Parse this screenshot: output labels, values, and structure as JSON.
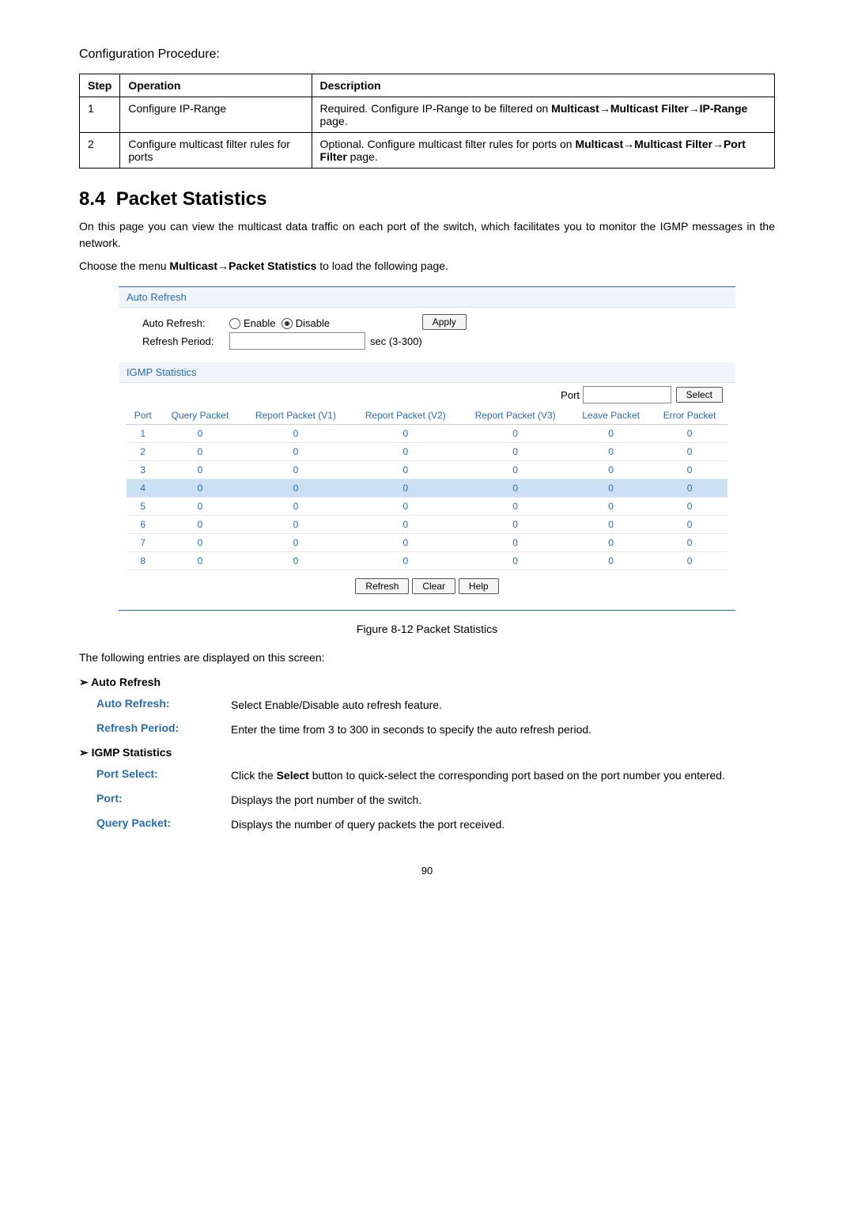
{
  "proc_title": "Configuration Procedure:",
  "table1": {
    "headers": [
      "Step",
      "Operation",
      "Description"
    ],
    "rows": [
      {
        "step": "1",
        "op": "Configure IP-Range",
        "desc_pre": "Required. Configure IP-Range to be filtered on ",
        "desc_bold": "Multicast→Multicast Filter→IP-Range",
        "desc_post": " page."
      },
      {
        "step": "2",
        "op": "Configure multicast filter rules for ports",
        "desc_pre": "Optional. Configure multicast filter rules for ports on ",
        "desc_bold": "Multicast→Multicast Filter→Port Filter",
        "desc_post": " page."
      }
    ]
  },
  "section_num": "8.4",
  "section_title": "Packet Statistics",
  "para1": "On this page you can view the multicast data traffic on each port of the switch, which facilitates you to monitor the IGMP messages in the network.",
  "para2_pre": "Choose the menu ",
  "para2_bold": "Multicast→Packet Statistics",
  "para2_post": " to load the following page.",
  "fig": {
    "auto_refresh_hdr": "Auto Refresh",
    "auto_refresh_label": "Auto Refresh:",
    "refresh_period_label": "Refresh Period:",
    "enable": "Enable",
    "disable": "Disable",
    "sec_hint": "sec (3-300)",
    "apply": "Apply",
    "igmp_hdr": "IGMP Statistics",
    "port_label": "Port",
    "select_btn": "Select",
    "cols": [
      "Port",
      "Query Packet",
      "Report Packet (V1)",
      "Report Packet (V2)",
      "Report Packet (V3)",
      "Leave Packet",
      "Error Packet"
    ],
    "rows": [
      {
        "port": "1",
        "q": "0",
        "r1": "0",
        "r2": "0",
        "r3": "0",
        "lv": "0",
        "er": "0"
      },
      {
        "port": "2",
        "q": "0",
        "r1": "0",
        "r2": "0",
        "r3": "0",
        "lv": "0",
        "er": "0"
      },
      {
        "port": "3",
        "q": "0",
        "r1": "0",
        "r2": "0",
        "r3": "0",
        "lv": "0",
        "er": "0"
      },
      {
        "port": "4",
        "q": "0",
        "r1": "0",
        "r2": "0",
        "r3": "0",
        "lv": "0",
        "er": "0",
        "sel": true
      },
      {
        "port": "5",
        "q": "0",
        "r1": "0",
        "r2": "0",
        "r3": "0",
        "lv": "0",
        "er": "0"
      },
      {
        "port": "6",
        "q": "0",
        "r1": "0",
        "r2": "0",
        "r3": "0",
        "lv": "0",
        "er": "0"
      },
      {
        "port": "7",
        "q": "0",
        "r1": "0",
        "r2": "0",
        "r3": "0",
        "lv": "0",
        "er": "0"
      },
      {
        "port": "8",
        "q": "0",
        "r1": "0",
        "r2": "0",
        "r3": "0",
        "lv": "0",
        "er": "0"
      }
    ],
    "refresh_btn": "Refresh",
    "clear_btn": "Clear",
    "help_btn": "Help"
  },
  "fig_caption": "Figure 8-12 Packet Statistics",
  "entries_intro": "The following entries are displayed on this screen:",
  "groups": [
    {
      "title": "Auto Refresh",
      "defs": [
        {
          "term": "Auto Refresh:",
          "text": "Select Enable/Disable auto refresh feature."
        },
        {
          "term": "Refresh Period:",
          "text": "Enter the time from 3 to 300 in seconds to specify the auto refresh period."
        }
      ]
    },
    {
      "title": "IGMP Statistics",
      "defs": [
        {
          "term": "Port Select:",
          "text_pre": "Click the ",
          "text_bold": "Select",
          "text_post": " button to quick-select the corresponding port based on the port number you entered."
        },
        {
          "term": "Port:",
          "text": "Displays the port number of the switch."
        },
        {
          "term": "Query Packet:",
          "text": "Displays the number of query packets the port received."
        }
      ]
    }
  ],
  "page_num": "90"
}
